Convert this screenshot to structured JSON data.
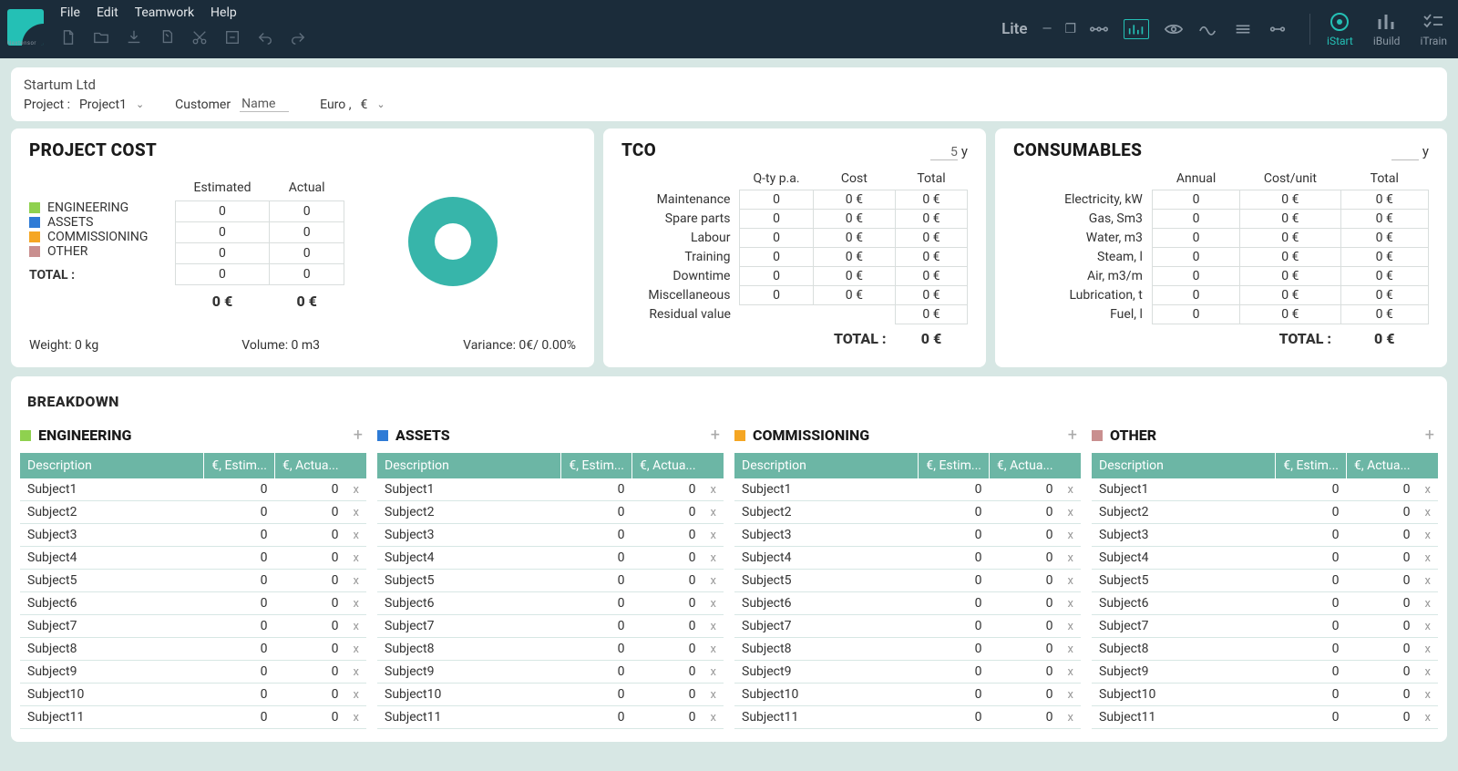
{
  "app": {
    "name": "Nextensor",
    "edition": "Lite"
  },
  "menu": {
    "file": "File",
    "edit": "Edit",
    "teamwork": "Teamwork",
    "help": "Help"
  },
  "modes": {
    "istart": "iStart",
    "ibuild": "iBuild",
    "itrain": "iTrain"
  },
  "project": {
    "company": "Startum Ltd",
    "proj_label": "Project :",
    "proj_name": "Project1",
    "cust_label": "Customer",
    "cust_name": "Name",
    "curr_label": "Euro ,",
    "curr_symbol": "€"
  },
  "pcost": {
    "title": "PROJECT COST",
    "head_est": "Estimated",
    "head_act": "Actual",
    "rows": [
      {
        "label": "ENGINEERING",
        "est": "0",
        "act": "0",
        "swatch": "g"
      },
      {
        "label": "ASSETS",
        "est": "0",
        "act": "0",
        "swatch": "b"
      },
      {
        "label": "COMMISSIONING",
        "est": "0",
        "act": "0",
        "swatch": "o"
      },
      {
        "label": "OTHER",
        "est": "0",
        "act": "0",
        "swatch": "r"
      }
    ],
    "total_label": "TOTAL :",
    "total_est": "0 €",
    "total_act": "0 €",
    "weight": "Weight: 0 kg",
    "volume": "Volume: 0 m3",
    "variance": "Variance: 0€/ 0.00%"
  },
  "tco": {
    "title": "TCO",
    "years": "5",
    "years_suffix": "y",
    "h1": "Q-ty p.a.",
    "h2": "Cost",
    "h3": "Total",
    "rows": [
      {
        "label": "Maintenance",
        "q": "0",
        "c": "0 €",
        "t": "0 €"
      },
      {
        "label": "Spare parts",
        "q": "0",
        "c": "0 €",
        "t": "0 €"
      },
      {
        "label": "Labour",
        "q": "0",
        "c": "0 €",
        "t": "0 €"
      },
      {
        "label": "Training",
        "q": "0",
        "c": "0 €",
        "t": "0 €"
      },
      {
        "label": "Downtime",
        "q": "0",
        "c": "0 €",
        "t": "0 €"
      },
      {
        "label": "Miscellaneous",
        "q": "0",
        "c": "0 €",
        "t": "0 €"
      },
      {
        "label": "Residual value",
        "q": "",
        "c": "",
        "t": "0 €"
      }
    ],
    "total_label": "TOTAL :",
    "total": "0 €"
  },
  "cons": {
    "title": "CONSUMABLES",
    "years": "",
    "years_suffix": "y",
    "h1": "Annual",
    "h2": "Cost/unit",
    "h3": "Total",
    "rows": [
      {
        "label": "Electricity, kW",
        "a": "0",
        "c": "0 €",
        "t": "0 €"
      },
      {
        "label": "Gas, Sm3",
        "a": "0",
        "c": "0 €",
        "t": "0 €"
      },
      {
        "label": "Water, m3",
        "a": "0",
        "c": "0 €",
        "t": "0 €"
      },
      {
        "label": "Steam, l",
        "a": "0",
        "c": "0 €",
        "t": "0 €"
      },
      {
        "label": "Air, m3/m",
        "a": "0",
        "c": "0 €",
        "t": "0 €"
      },
      {
        "label": "Lubrication, t",
        "a": "0",
        "c": "0 €",
        "t": "0 €"
      },
      {
        "label": "Fuel, l",
        "a": "0",
        "c": "0 €",
        "t": "0 €"
      }
    ],
    "total_label": "TOTAL :",
    "total": "0 €"
  },
  "breakdown": {
    "title": "BREAKDOWN",
    "hdesc": "Description",
    "hest": "€, Estim...",
    "hact": "€, Actua...",
    "sections": [
      {
        "label": "ENGINEERING",
        "swatch": "g"
      },
      {
        "label": "ASSETS",
        "swatch": "b"
      },
      {
        "label": "COMMISSIONING",
        "swatch": "o"
      },
      {
        "label": "OTHER",
        "swatch": "r"
      }
    ],
    "rows": [
      {
        "d": "Subject1",
        "e": "0",
        "a": "0"
      },
      {
        "d": "Subject2",
        "e": "0",
        "a": "0"
      },
      {
        "d": "Subject3",
        "e": "0",
        "a": "0"
      },
      {
        "d": "Subject4",
        "e": "0",
        "a": "0"
      },
      {
        "d": "Subject5",
        "e": "0",
        "a": "0"
      },
      {
        "d": "Subject6",
        "e": "0",
        "a": "0"
      },
      {
        "d": "Subject7",
        "e": "0",
        "a": "0"
      },
      {
        "d": "Subject8",
        "e": "0",
        "a": "0"
      },
      {
        "d": "Subject9",
        "e": "0",
        "a": "0"
      },
      {
        "d": "Subject10",
        "e": "0",
        "a": "0"
      },
      {
        "d": "Subject11",
        "e": "0",
        "a": "0"
      }
    ]
  },
  "sym": {
    "x": "x",
    "plus": "+"
  }
}
